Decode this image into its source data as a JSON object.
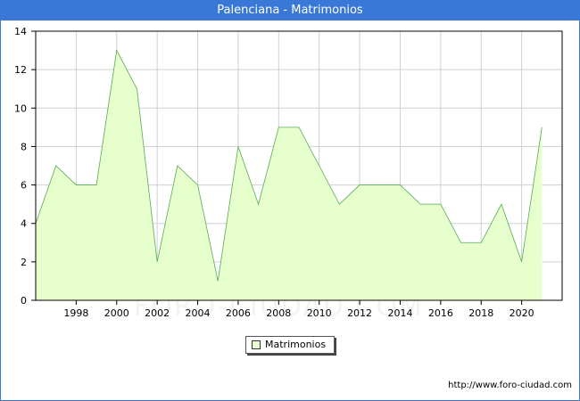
{
  "title": "Palenciana - Matrimonios",
  "footer_url": "http://www.foro-ciudad.com",
  "watermark": "FORO-CIUDAD.COM",
  "legend": {
    "label": "Matrimonios"
  },
  "colors": {
    "title_bar": "#3a78d8",
    "area_fill": "#e6ffcc",
    "line": "#55aa55",
    "grid": "#d0d0d0"
  },
  "chart_data": {
    "type": "area",
    "title": "Palenciana - Matrimonios",
    "xlabel": "",
    "ylabel": "",
    "xlim": [
      1996,
      2022
    ],
    "ylim": [
      0,
      14
    ],
    "x_ticks": [
      1998,
      2000,
      2002,
      2004,
      2006,
      2008,
      2010,
      2012,
      2014,
      2016,
      2018,
      2020
    ],
    "y_ticks": [
      0,
      2,
      4,
      6,
      8,
      10,
      12,
      14
    ],
    "grid": true,
    "legend_position": "bottom-center",
    "series": [
      {
        "name": "Matrimonios",
        "x": [
          1996,
          1997,
          1998,
          1999,
          2000,
          2001,
          2002,
          2003,
          2004,
          2005,
          2006,
          2007,
          2008,
          2009,
          2010,
          2011,
          2012,
          2013,
          2014,
          2015,
          2016,
          2017,
          2018,
          2019,
          2020,
          2021
        ],
        "values": [
          4,
          7,
          6,
          6,
          13,
          11,
          2,
          7,
          6,
          1,
          8,
          5,
          9,
          9,
          7,
          5,
          6,
          6,
          6,
          5,
          5,
          3,
          3,
          5,
          2,
          9
        ]
      }
    ]
  }
}
